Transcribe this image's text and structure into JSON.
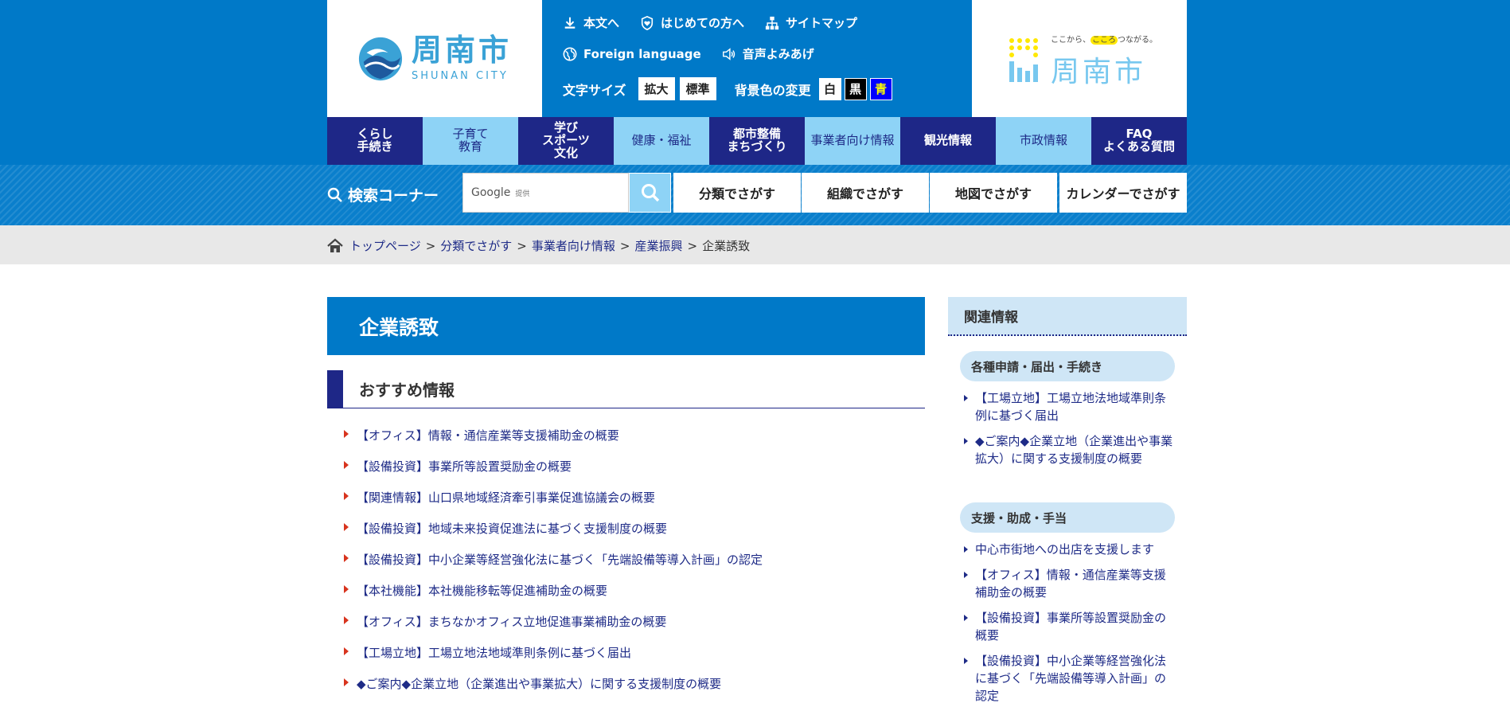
{
  "header": {
    "logo": {
      "name_jp": "周南市",
      "name_en": "SHUNAN CITY"
    },
    "util_links": [
      {
        "label": "本文へ",
        "icon": "download-icon"
      },
      {
        "label": "はじめての方へ",
        "icon": "shield-heart-icon"
      },
      {
        "label": "サイトマップ",
        "icon": "sitemap-icon"
      },
      {
        "label": "Foreign language",
        "icon": "globe-icon"
      },
      {
        "label": "音声よみあげ",
        "icon": "speaker-icon"
      }
    ],
    "font_size": {
      "label": "文字サイズ",
      "enlarge": "拡大",
      "standard": "標準"
    },
    "bg_color": {
      "label": "背景色の変更",
      "white": "白",
      "black": "黒",
      "blue": "青"
    },
    "banner": {
      "tagline_pre": "ここから、",
      "tagline_hl": "こころ",
      "tagline_post": "つながる。",
      "city": "周南市"
    }
  },
  "nav": [
    {
      "label": "くらし\n手続き",
      "style": "dark"
    },
    {
      "label": "子育て\n教育",
      "style": "light"
    },
    {
      "label": "学び\nスポーツ\n文化",
      "style": "dark"
    },
    {
      "label": "健康・福祉",
      "style": "light"
    },
    {
      "label": "都市整備\nまちづくり",
      "style": "dark"
    },
    {
      "label": "事業者向け情報",
      "style": "light"
    },
    {
      "label": "観光情報",
      "style": "dark"
    },
    {
      "label": "市政情報",
      "style": "light"
    },
    {
      "label": "FAQ\nよくある質問",
      "style": "dark"
    }
  ],
  "search": {
    "title": "検索コーナー",
    "google_label": "Google",
    "provided_label": "提供",
    "buttons": [
      "分類でさがす",
      "組織でさがす",
      "地図でさがす",
      "カレンダーでさがす"
    ]
  },
  "breadcrumb": {
    "items": [
      "トップページ",
      "分類でさがす",
      "事業者向け情報",
      "産業振興"
    ],
    "current": "企業誘致",
    "separator": ">"
  },
  "main": {
    "title": "企業誘致",
    "section_title": "おすすめ情報",
    "items": [
      "【オフィス】情報・通信産業等支援補助金の概要",
      "【設備投資】事業所等設置奨励金の概要",
      "【関連情報】山口県地域経済牽引事業促進協議会の概要",
      "【設備投資】地域未来投資促進法に基づく支援制度の概要",
      "【設備投資】中小企業等経営強化法に基づく「先端設備等導入計画」の認定",
      "【本社機能】本社機能移転等促進補助金の概要",
      "【オフィス】まちなかオフィス立地促進事業補助金の概要",
      "【工場立地】工場立地法地域準則条例に基づく届出",
      "◆ご案内◆企業立地（企業進出や事業拡大）に関する支援制度の概要"
    ]
  },
  "sidebar": {
    "title": "関連情報",
    "groups": [
      {
        "title": "各種申請・届出・手続き",
        "items": [
          "【工場立地】工場立地法地域準則条例に基づく届出",
          "◆ご案内◆企業立地（企業進出や事業拡大）に関する支援制度の概要"
        ]
      },
      {
        "title": "支援・助成・手当",
        "items": [
          "中心市街地への出店を支援します",
          "【オフィス】情報・通信産業等支援補助金の概要",
          "【設備投資】事業所等設置奨励金の概要",
          "【設備投資】中小企業等経営強化法に基づく「先端設備等導入計画」の認定"
        ]
      }
    ]
  },
  "colors": {
    "brand_blue": "#0079c8",
    "navy": "#1e2787",
    "light_blue": "#8ed3f6",
    "bullet_red": "#d8341e"
  }
}
